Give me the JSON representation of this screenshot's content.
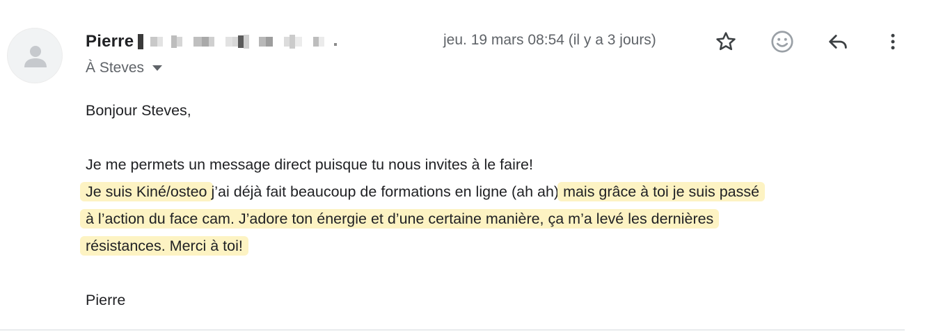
{
  "message": {
    "sender_name": "Pierre",
    "date": "jeu. 19 mars 08:54 (il y a 3 jours)",
    "recipient_label": "À Steves",
    "actions": {
      "star": "star-icon",
      "emoji": "emoji-icon",
      "reply": "reply-icon",
      "more": "more-vert-icon"
    },
    "body": {
      "greeting": "Bonjour Steves,",
      "line1": "Je me permets un message direct puisque tu nous invites à le faire!",
      "line2_highlight_a": "Je suis Kiné/osteo",
      "line2_plain": " j’ai déjà fait beaucoup de formations en ligne (ah ah) ",
      "line2_highlight_b": "mais grâce à toi je suis passé",
      "line3_highlight": "à l’action du face cam. J’adore ton énergie et d’une certaine manière, ça m’a levé les dernières",
      "line4_highlight": "résistances. Merci à toi!",
      "signature": "Pierre"
    },
    "colors": {
      "highlight": "#fdf3c3",
      "meta_text": "#5f6368",
      "icon": "#3c4043"
    }
  }
}
